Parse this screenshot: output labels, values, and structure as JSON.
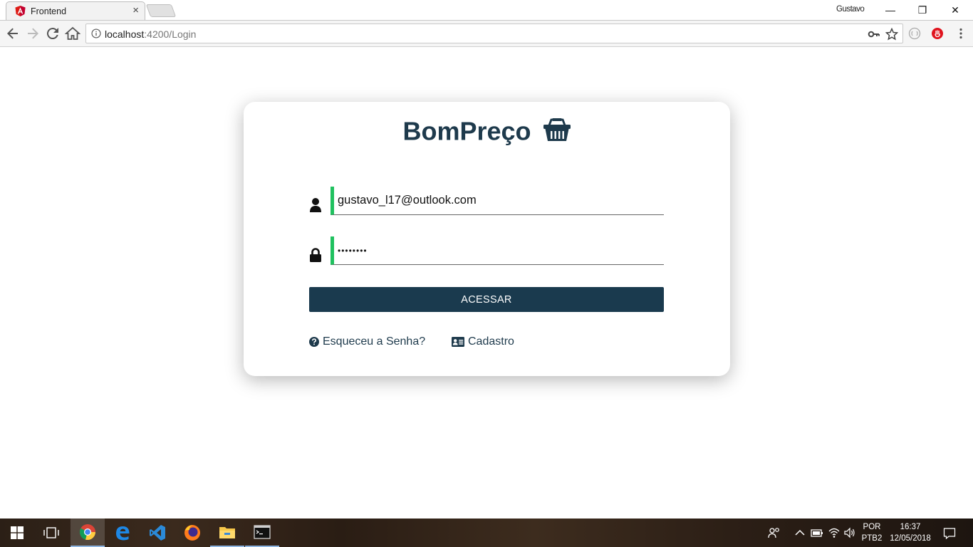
{
  "browser": {
    "tab": {
      "title": "Frontend",
      "close": "×"
    },
    "profile": "Gustavo",
    "window_controls": {
      "minimize": "—",
      "restore": "❐",
      "close": "✕"
    },
    "address": {
      "host": "localhost",
      "path": ":4200/Login"
    }
  },
  "page": {
    "brand": "BomPreço",
    "email_value": "gustavo_l17@outlook.com",
    "password_value": "12345678",
    "submit_label": "ACESSAR",
    "forgot_label": "Esqueceu a Senha?",
    "register_label": "Cadastro"
  },
  "taskbar": {
    "apps": [
      "start-icon",
      "task-view-icon",
      "chrome-icon",
      "edge-icon",
      "vscode-icon",
      "firefox-icon",
      "file-explorer-icon",
      "terminal-icon"
    ],
    "lang_top": "POR",
    "lang_bottom": "PTB2",
    "time": "16:37",
    "date": "12/05/2018"
  },
  "colors": {
    "brand_text": "#1e3a4c",
    "button": "#1a3a4e",
    "input_accent": "#20c15f"
  }
}
